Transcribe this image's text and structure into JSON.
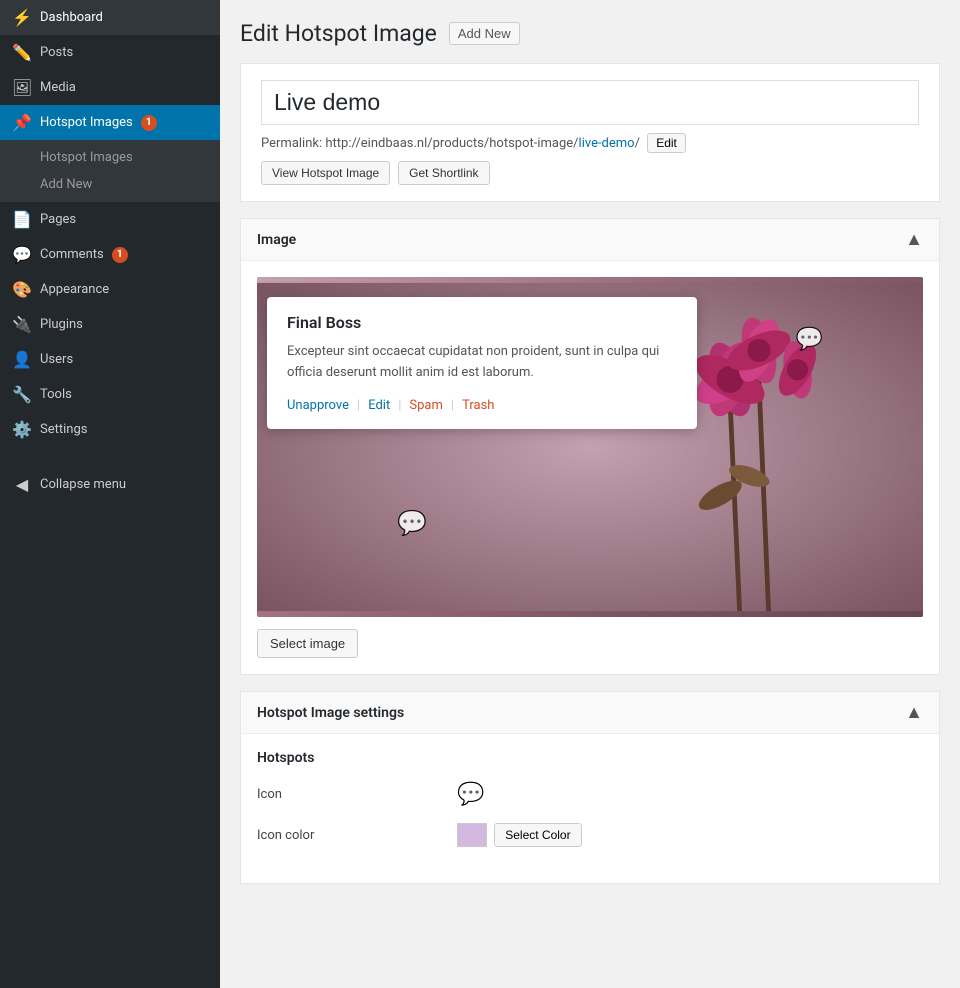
{
  "sidebar": {
    "items": [
      {
        "id": "dashboard",
        "label": "Dashboard",
        "icon": "⚡",
        "active": false
      },
      {
        "id": "posts",
        "label": "Posts",
        "icon": "✏️",
        "active": false
      },
      {
        "id": "media",
        "label": "Media",
        "icon": "🖼",
        "active": false
      },
      {
        "id": "hotspot-images",
        "label": "Hotspot Images",
        "icon": "📌",
        "active": true,
        "badge": "1"
      },
      {
        "id": "pages",
        "label": "Pages",
        "icon": "📄",
        "active": false
      },
      {
        "id": "comments",
        "label": "Comments",
        "icon": "💬",
        "active": false,
        "badge": "1"
      },
      {
        "id": "appearance",
        "label": "Appearance",
        "icon": "🎨",
        "active": false
      },
      {
        "id": "plugins",
        "label": "Plugins",
        "icon": "🔌",
        "active": false
      },
      {
        "id": "users",
        "label": "Users",
        "icon": "👤",
        "active": false
      },
      {
        "id": "tools",
        "label": "Tools",
        "icon": "🔧",
        "active": false
      },
      {
        "id": "settings",
        "label": "Settings",
        "icon": "⚙️",
        "active": false
      }
    ],
    "submenu_items": [
      {
        "id": "hotspot-images-all",
        "label": "Hotspot Images"
      },
      {
        "id": "hotspot-images-add",
        "label": "Add New"
      }
    ],
    "collapse_label": "Collapse menu"
  },
  "header": {
    "title": "Edit Hotspot Image",
    "add_new_label": "Add New"
  },
  "post": {
    "title": "Live demo",
    "permalink_prefix": "Permalink: http://eindbaas.nl/products/hotspot-image/",
    "permalink_slug": "live-demo",
    "permalink_suffix": "/",
    "edit_btn": "Edit",
    "view_btn": "View Hotspot Image",
    "shortlink_btn": "Get Shortlink"
  },
  "image_panel": {
    "title": "Image",
    "select_image_btn": "Select image"
  },
  "tooltip": {
    "title": "Final Boss",
    "body": "Excepteur sint occaecat cupidatat non proident, sunt in culpa qui officia deserunt mollit anim id est laborum.",
    "unapprove": "Unapprove",
    "edit": "Edit",
    "spam": "Spam",
    "trash": "Trash"
  },
  "settings_panel": {
    "title": "Hotspot Image settings",
    "hotspots_section": "Hotspots",
    "icon_label": "Icon",
    "icon_symbol": "💬",
    "icon_color_label": "Icon color",
    "select_color_btn": "Select Color"
  }
}
